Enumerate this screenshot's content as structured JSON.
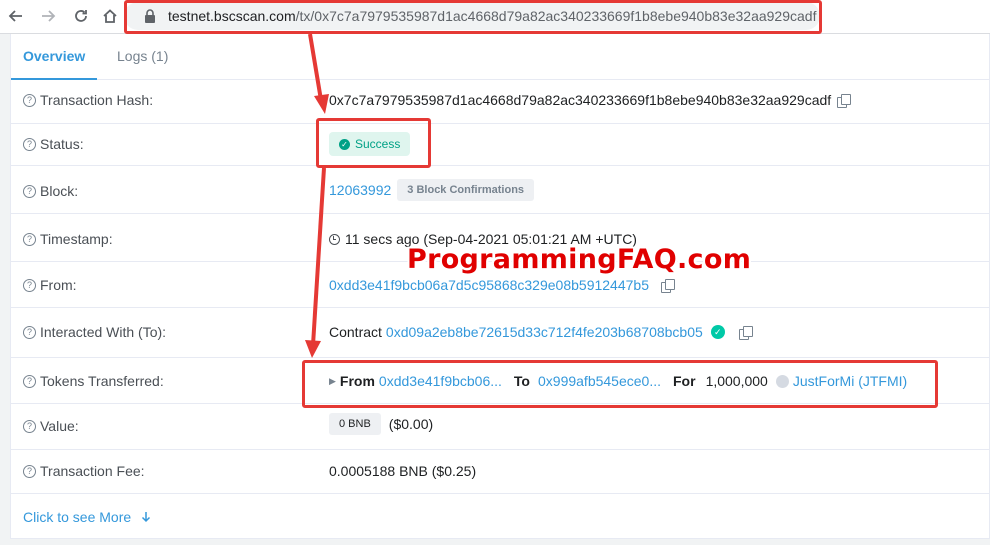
{
  "browser": {
    "url_host": "testnet.bscscan.com",
    "url_path": "/tx/0x7c7a7979535987d1ac4668d79a82ac340233669f1b8ebe940b83e32aa929cadf"
  },
  "tabs": [
    {
      "label": "Overview"
    },
    {
      "label": "Logs (1)"
    }
  ],
  "rows": {
    "tx_hash": {
      "label": "Transaction Hash:",
      "value": "0x7c7a7979535987d1ac4668d79a82ac340233669f1b8ebe940b83e32aa929cadf"
    },
    "status": {
      "label": "Status:",
      "value": "Success"
    },
    "block": {
      "label": "Block:",
      "value": "12063992",
      "confirmations": "3 Block Confirmations"
    },
    "timestamp": {
      "label": "Timestamp:",
      "value": "11 secs ago (Sep-04-2021 05:01:21 AM +UTC)"
    },
    "from": {
      "label": "From:",
      "value": "0xdd3e41f9bcb06a7d5c95868c329e08b5912447b5"
    },
    "interacted": {
      "label": "Interacted With (To):",
      "prefix": "Contract",
      "value": "0xd09a2eb8be72615d33c712f4fe203b68708bcb05"
    },
    "tokens": {
      "label": "Tokens Transferred:",
      "from_label": "From",
      "from": "0xdd3e41f9bcb06...",
      "to_label": "To",
      "to": "0x999afb545ece0...",
      "for_label": "For",
      "amount": "1,000,000",
      "token": "JustForMi (JTFMI)"
    },
    "value": {
      "label": "Value:",
      "amount": "0 BNB",
      "usd": "($0.00)"
    },
    "fee": {
      "label": "Transaction Fee:",
      "value": "0.0005188 BNB ($0.25)"
    }
  },
  "more": {
    "label": "Click to see More"
  },
  "watermark": "ProgrammingFAQ.com",
  "colors": {
    "accent": "#3498db",
    "success": "#00a186",
    "annotation": "#e53935"
  }
}
